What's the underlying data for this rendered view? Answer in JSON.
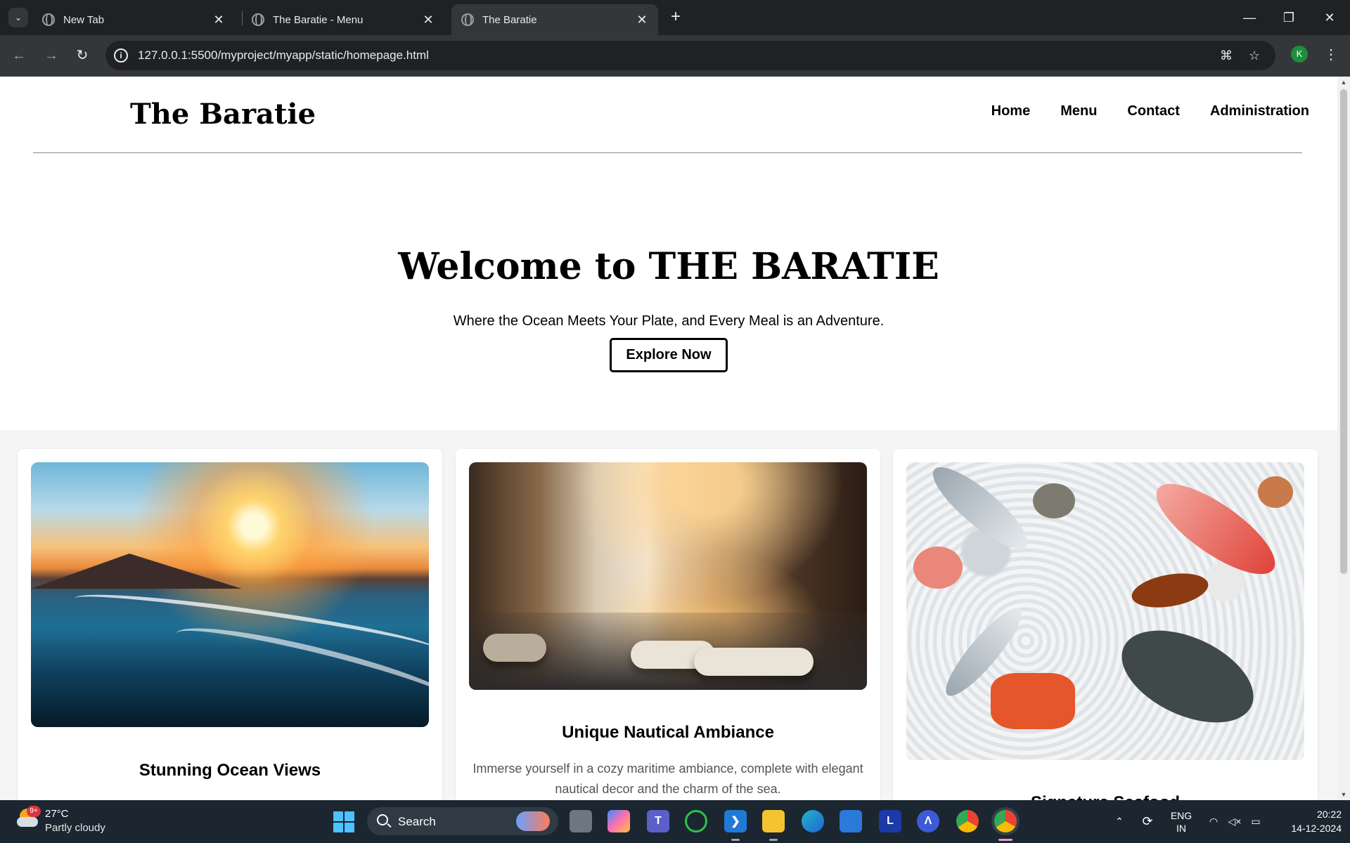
{
  "browser": {
    "tabs": [
      {
        "title": "New Tab",
        "active": false
      },
      {
        "title": "The Baratie - Menu",
        "active": false
      },
      {
        "title": "The Baratie",
        "active": true
      }
    ],
    "url": "127.0.0.1:5500/myproject/myapp/static/homepage.html",
    "profile_initial": "K"
  },
  "site": {
    "logo": "The Baratie",
    "nav": [
      "Home",
      "Menu",
      "Contact",
      "Administration"
    ],
    "hero": {
      "title": "Welcome to THE BARATIE",
      "subtitle": "Where the Ocean Meets Your Plate, and Every Meal is an Adventure.",
      "cta": "Explore Now"
    },
    "features": [
      {
        "title": "Stunning Ocean Views",
        "text": ""
      },
      {
        "title": "Unique Nautical Ambiance",
        "text": "Immerse yourself in a cozy maritime ambiance, complete with elegant nautical decor and the charm of the sea."
      },
      {
        "title": "Signature Seafood",
        "text": ""
      }
    ]
  },
  "taskbar": {
    "weather_badge": "9+",
    "temperature": "27°C",
    "weather": "Partly cloudy",
    "search_label": "Search",
    "lang_top": "ENG",
    "lang_bottom": "IN",
    "time": "20:22",
    "date": "14-12-2024"
  }
}
